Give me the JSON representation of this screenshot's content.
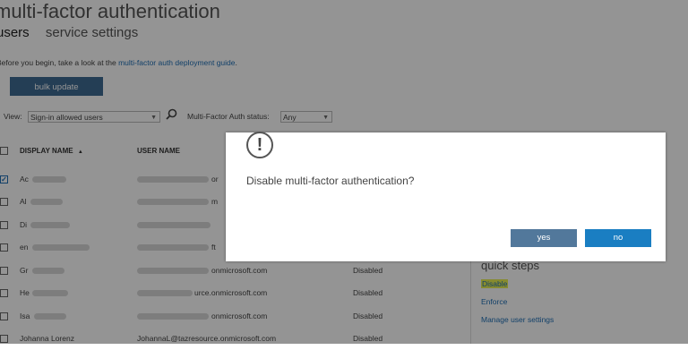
{
  "header": {
    "title": "multi-factor authentication",
    "tabs": [
      {
        "label": "users",
        "active": true
      },
      {
        "label": "service settings",
        "active": false
      }
    ]
  },
  "intro": {
    "text": "Before you begin, take a look at the ",
    "link": "multi-factor auth deployment guide",
    "suffix": "."
  },
  "bulk_update_label": "bulk update",
  "filters": {
    "view_label": "View:",
    "view_value": "Sign-in allowed users",
    "status_label": "Multi-Factor Auth status:",
    "status_value": "Any"
  },
  "table": {
    "columns": {
      "display_name": "DISPLAY NAME",
      "sort_indicator": "▲",
      "user_name": "USER NAME"
    },
    "rows": [
      {
        "display_name": "Ac",
        "user_name_visible": "or",
        "status": "",
        "checked": true
      },
      {
        "display_name": "Al",
        "user_name_visible": "m",
        "status": "",
        "checked": false
      },
      {
        "display_name": "Di",
        "user_name_visible": "",
        "status": "",
        "checked": false
      },
      {
        "display_name": "en",
        "user_name_visible": "ft",
        "status": "",
        "checked": false
      },
      {
        "display_name": "Gr",
        "user_name_visible": "onmicrosoft.com",
        "status": "Disabled",
        "checked": false
      },
      {
        "display_name": "He",
        "user_name_visible": "urce.onmicrosoft.com",
        "status": "Disabled",
        "checked": false
      },
      {
        "display_name": "Isa",
        "user_name_visible": "onmicrosoft.com",
        "status": "Disabled",
        "checked": false
      },
      {
        "display_name": "Johanna Lorenz",
        "user_name_visible": "JohannaL@tazresource.onmicrosoft.com",
        "status": "Disabled",
        "checked": false
      }
    ]
  },
  "dialog": {
    "icon": "exclamation-icon",
    "icon_glyph": "!",
    "message": "Disable multi-factor authentication?",
    "yes_label": "yes",
    "no_label": "no"
  },
  "quick_steps": {
    "title": "quick steps",
    "disable": "Disable",
    "enforce": "Enforce",
    "manage": "Manage user settings"
  },
  "colors": {
    "accent": "#1a7ec2",
    "yes_button": "#52789b",
    "bulk_button": "#3f6b93",
    "highlight": "#e9ef52"
  }
}
